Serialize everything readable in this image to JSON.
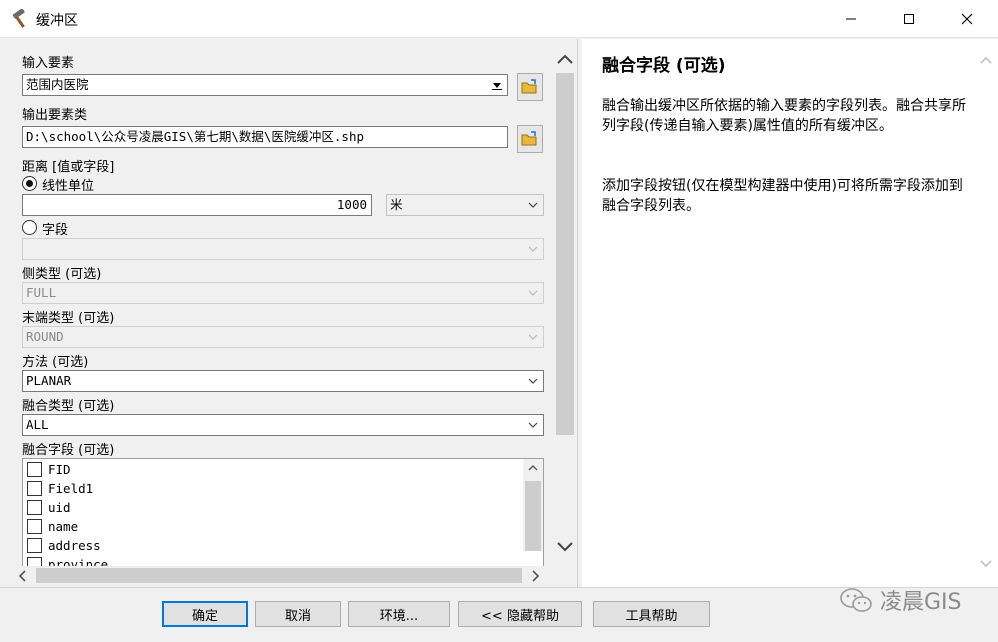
{
  "window": {
    "title": "缓冲区"
  },
  "form": {
    "input_features": {
      "label": "输入要素",
      "value": "范围内医院"
    },
    "output_class": {
      "label": "输出要素类",
      "value": "D:\\school\\公众号凌晨GIS\\第七期\\数据\\医院缓冲区.shp"
    },
    "distance": {
      "label": "距离 [值或字段]",
      "linear_unit_label": "线性单位",
      "linear_value": "1000",
      "unit": "米",
      "field_label": "字段",
      "field_value": ""
    },
    "side_type": {
      "label": "侧类型 (可选)",
      "value": "FULL"
    },
    "end_type": {
      "label": "末端类型 (可选)",
      "value": "ROUND"
    },
    "method": {
      "label": "方法 (可选)",
      "value": "PLANAR"
    },
    "dissolve_type": {
      "label": "融合类型 (可选)",
      "value": "ALL"
    },
    "dissolve_fields": {
      "label": "融合字段 (可选)",
      "items": [
        "FID",
        "Field1",
        "uid",
        "name",
        "address",
        "province"
      ]
    }
  },
  "help": {
    "title": "融合字段 (可选)",
    "para1": "融合输出缓冲区所依据的输入要素的字段列表。融合共享所列字段(传递自输入要素)属性值的所有缓冲区。",
    "para2": "添加字段按钮(仅在模型构建器中使用)可将所需字段添加到融合字段列表。"
  },
  "buttons": {
    "ok": "确定",
    "cancel": "取消",
    "env": "环境...",
    "hide_help": "<< 隐藏帮助",
    "tool_help": "工具帮助"
  },
  "watermark": "凌晨GIS"
}
